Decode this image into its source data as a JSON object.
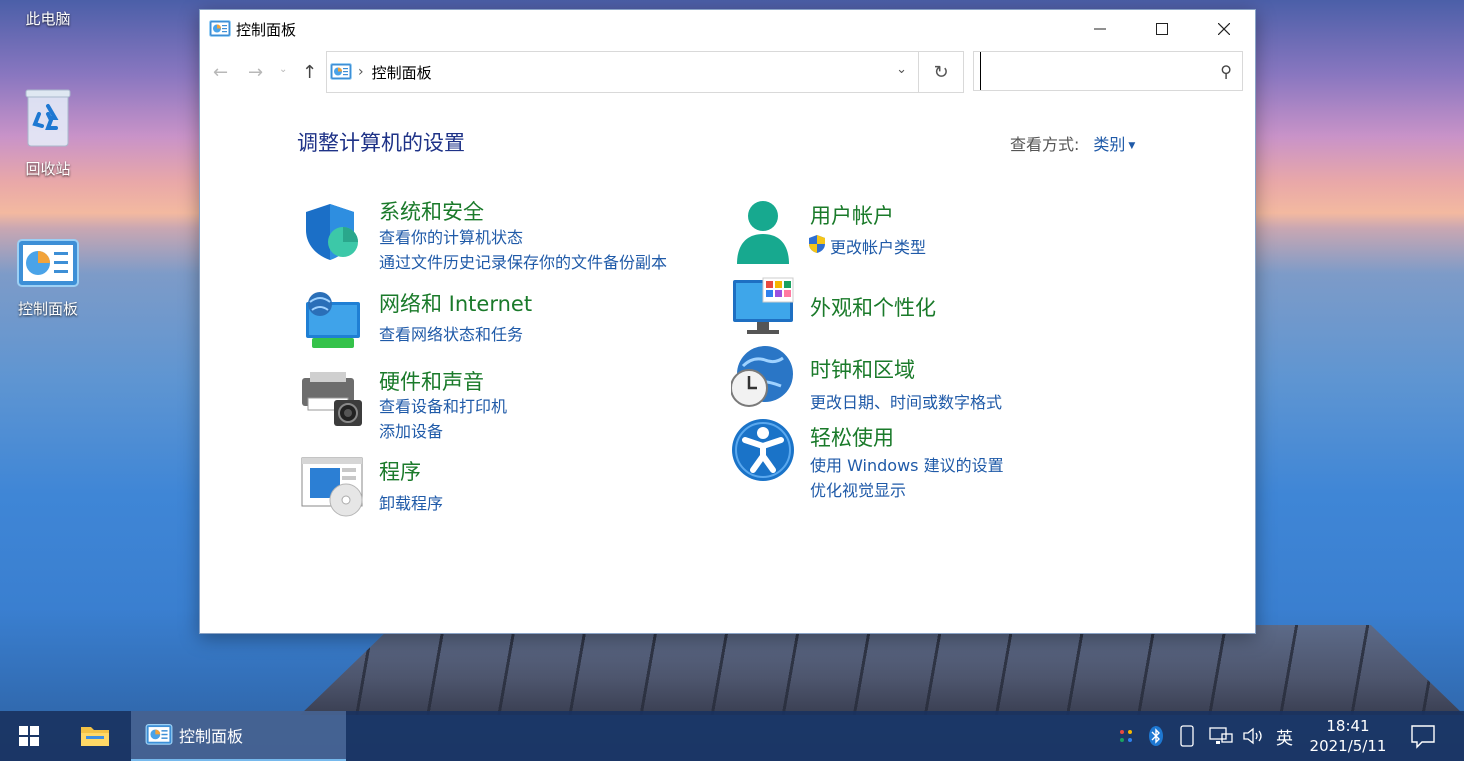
{
  "desktop": {
    "icons": [
      {
        "label": "此电脑"
      },
      {
        "label": "回收站"
      },
      {
        "label": "控制面板"
      }
    ]
  },
  "window": {
    "title": "控制面板",
    "address": {
      "crumb": "控制面板",
      "separator": "›"
    },
    "search": {
      "placeholder": "",
      "value": ""
    },
    "heading": "调整计算机的设置",
    "view_by": {
      "label": "查看方式:",
      "value": "类别"
    },
    "categories": [
      {
        "title": "系统和安全",
        "links": [
          "查看你的计算机状态",
          "通过文件历史记录保存你的文件备份副本"
        ]
      },
      {
        "title": "网络和 Internet",
        "links": [
          "查看网络状态和任务"
        ]
      },
      {
        "title": "硬件和声音",
        "links": [
          "查看设备和打印机",
          "添加设备"
        ]
      },
      {
        "title": "程序",
        "links": [
          "卸载程序"
        ]
      },
      {
        "title": "用户帐户",
        "links": [
          "更改帐户类型"
        ]
      },
      {
        "title": "外观和个性化",
        "links": []
      },
      {
        "title": "时钟和区域",
        "links": [
          "更改日期、时间或数字格式"
        ]
      },
      {
        "title": "轻松使用",
        "links": [
          "使用 Windows 建议的设置",
          "优化视觉显示"
        ]
      }
    ]
  },
  "taskbar": {
    "active_app": "控制面板",
    "ime": "英",
    "time": "18:41",
    "date": "2021/5/11"
  },
  "colors": {
    "category_title": "#1a7a2a",
    "link": "#1f5aa8",
    "heading": "#1e3287"
  }
}
